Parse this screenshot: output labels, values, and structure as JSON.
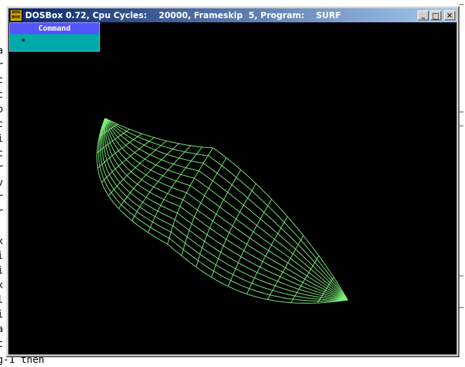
{
  "window": {
    "title": "DOSBox 0.72, Cpu Cycles:    20000, Frameskip  5, Program:    SURF",
    "icon": "dosbox-icon",
    "icon_text_top": "DOS",
    "icon_text_bottom": "BOX",
    "minimize_label": "_",
    "maximize_label": "□",
    "close_label": "✕"
  },
  "program_menu": {
    "header": "Command",
    "items": [
      "*"
    ]
  },
  "background": {
    "left_chars": [
      "a",
      "r",
      "c",
      "c",
      "b",
      "c",
      "i",
      "c",
      "r",
      "v",
      "r",
      "r",
      "",
      "x",
      "i",
      "i",
      "x",
      "l",
      "i",
      "a",
      "c"
    ],
    "bottom_text": "g-1  then"
  },
  "colors": {
    "screen_bg": "#000000",
    "mesh_line": "#7cf07c",
    "menu_header": "#5555ff",
    "menu_item": "#00aaaa",
    "titlebar_start": "#0a246a",
    "titlebar_end": "#a6caf0"
  },
  "surface": {
    "name": "3D wireframe surface",
    "u_lines": 18,
    "v_lines": 14
  }
}
